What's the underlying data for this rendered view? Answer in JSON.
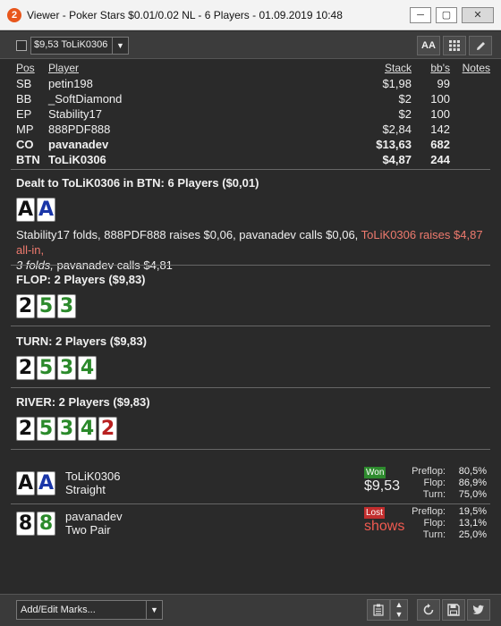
{
  "window": {
    "title": "Viewer - Poker Stars $0.01/0.02 NL - 6 Players - 01.09.2019 10:48",
    "logo_text": "2"
  },
  "toolbar": {
    "hand_select": "$9,53 ToLiK0306",
    "font_btn": "AA"
  },
  "players_table": {
    "headers": {
      "pos": "Pos",
      "player": "Player",
      "stack": "Stack",
      "bbs": "bb's",
      "notes": "Notes"
    },
    "rows": [
      {
        "pos": "SB",
        "player": "petin198",
        "stack": "$1,98",
        "bbs": "99",
        "bold": false
      },
      {
        "pos": "BB",
        "player": "_SoftDiamond",
        "stack": "$2",
        "bbs": "100",
        "bold": false
      },
      {
        "pos": "EP",
        "player": "Stability17",
        "stack": "$2",
        "bbs": "100",
        "bold": false
      },
      {
        "pos": "MP",
        "player": "888PDF888",
        "stack": "$2,84",
        "bbs": "142",
        "bold": false
      },
      {
        "pos": "CO",
        "player": "pavanadev",
        "stack": "$13,63",
        "bbs": "682",
        "bold": true
      },
      {
        "pos": "BTN",
        "player": "ToLiK0306",
        "stack": "$4,87",
        "bbs": "244",
        "bold": true
      }
    ]
  },
  "preflop": {
    "title": "Dealt to ToLiK0306 in BTN: 6 Players ($0,01)",
    "hero_cards": [
      {
        "rank": "A",
        "suit": "s"
      },
      {
        "rank": "A",
        "suit": "d"
      }
    ],
    "action_line1": "Stability17 folds, 888PDF888 raises $0,06, pavanadev calls $0,06, ",
    "action_allin": "ToLiK0306 raises $4,87 all-in,",
    "action_line2": "3 folds,",
    "action_line3": " pavanadev calls $4,81"
  },
  "flop": {
    "title": "FLOP: 2 Players ($9,83)",
    "cards": [
      {
        "rank": "2",
        "suit": "s"
      },
      {
        "rank": "5",
        "suit": "c"
      },
      {
        "rank": "3",
        "suit": "c"
      }
    ]
  },
  "turn": {
    "title": "TURN: 2 Players ($9,83)",
    "cards": [
      {
        "rank": "2",
        "suit": "s"
      },
      {
        "rank": "5",
        "suit": "c"
      },
      {
        "rank": "3",
        "suit": "c"
      },
      {
        "rank": "4",
        "suit": "c"
      }
    ]
  },
  "river": {
    "title": "RIVER: 2 Players ($9,83)",
    "cards": [
      {
        "rank": "2",
        "suit": "s"
      },
      {
        "rank": "5",
        "suit": "c"
      },
      {
        "rank": "3",
        "suit": "c"
      },
      {
        "rank": "4",
        "suit": "c"
      },
      {
        "rank": "2",
        "suit": "h"
      }
    ]
  },
  "showdown": [
    {
      "player": "ToLiK0306",
      "hand": "Straight",
      "cards": [
        {
          "rank": "A",
          "suit": "s"
        },
        {
          "rank": "A",
          "suit": "d"
        }
      ],
      "badge": "Won",
      "amount": "$9,53",
      "equity": [
        {
          "label": "Preflop:",
          "value": "80,5%"
        },
        {
          "label": "Flop:",
          "value": "86,9%"
        },
        {
          "label": "Turn:",
          "value": "75,0%"
        }
      ]
    },
    {
      "player": "pavanadev",
      "hand": "Two Pair",
      "cards": [
        {
          "rank": "8",
          "suit": "s"
        },
        {
          "rank": "8",
          "suit": "c"
        }
      ],
      "badge": "Lost",
      "amount": "shows",
      "equity": [
        {
          "label": "Preflop:",
          "value": "19,5%"
        },
        {
          "label": "Flop:",
          "value": "13,1%"
        },
        {
          "label": "Turn:",
          "value": "25,0%"
        }
      ]
    }
  ],
  "bottombar": {
    "marks_placeholder": "Add/Edit Marks..."
  },
  "colors": {
    "spade": "#111111",
    "diamond": "#1a36a8",
    "club": "#2b8a2b",
    "heart": "#b82020",
    "allin_text": "#ee7a6e"
  }
}
